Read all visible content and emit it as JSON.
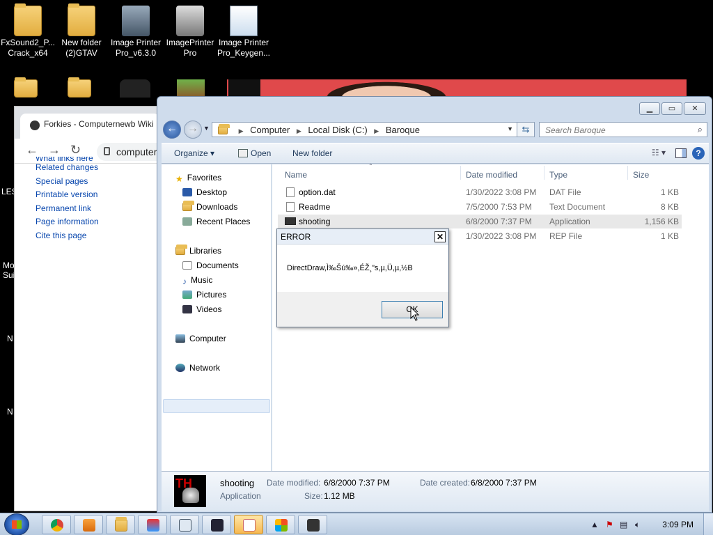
{
  "desktop": {
    "icons": [
      {
        "label": "FxSound2_P... Crack_x64"
      },
      {
        "label": "New folder (2)GTAV"
      },
      {
        "label": "Image Printer Pro_v6.3.0"
      },
      {
        "label": "ImagePrinter Pro"
      },
      {
        "label": "Image Printer Pro_Keygen..."
      }
    ],
    "edge_labels": [
      "LES",
      "Mo",
      "Sui",
      "N",
      "N"
    ]
  },
  "browser": {
    "tab_title": "Forkies - Computernewb Wiki",
    "url": "computer",
    "sidebar_links": [
      "What links here",
      "Related changes",
      "Special pages",
      "Printable version",
      "Permanent link",
      "Page information",
      "Cite this page"
    ]
  },
  "explorer": {
    "breadcrumb": [
      "Computer",
      "Local Disk (C:)",
      "Baroque"
    ],
    "search_placeholder": "Search Baroque",
    "toolbar": {
      "organize": "Organize",
      "open": "Open",
      "new_folder": "New folder"
    },
    "nav": {
      "favorites": "Favorites",
      "desktop": "Desktop",
      "downloads": "Downloads",
      "recent": "Recent Places",
      "libraries": "Libraries",
      "documents": "Documents",
      "music": "Music",
      "pictures": "Pictures",
      "videos": "Videos",
      "computer": "Computer",
      "network": "Network"
    },
    "columns": {
      "name": "Name",
      "date": "Date modified",
      "type": "Type",
      "size": "Size"
    },
    "files": [
      {
        "name": "option.dat",
        "date": "1/30/2022 3:08 PM",
        "type": "DAT File",
        "size": "1 KB"
      },
      {
        "name": "Readme",
        "date": "7/5/2000 7:53 PM",
        "type": "Text Document",
        "size": "8 KB"
      },
      {
        "name": "shooting",
        "date": "6/8/2000 7:37 PM",
        "type": "Application",
        "size": "1,156 KB"
      },
      {
        "name": "",
        "date": "1/30/2022 3:08 PM",
        "type": "REP File",
        "size": "1 KB"
      }
    ],
    "details": {
      "name": "shooting",
      "kind": "Application",
      "modified_label": "Date modified:",
      "modified": "6/8/2000 7:37 PM",
      "created_label": "Date created:",
      "created": "6/8/2000 7:37 PM",
      "size_label": "Size:",
      "size": "1.12 MB"
    }
  },
  "dialog": {
    "title": "ERROR",
    "message": "DirectDraw,Ì‰Šú‰»,ÉŽ¸”s,µ,Ü,µ,½B",
    "ok": "OK"
  },
  "taskbar": {
    "clock": "3:09 PM"
  }
}
